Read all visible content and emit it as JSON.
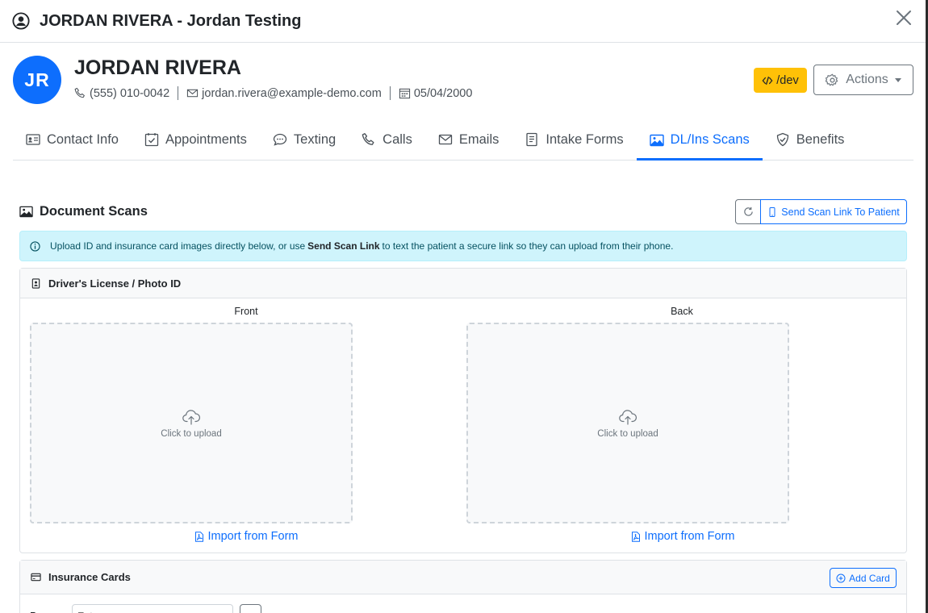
{
  "modal": {
    "title": "JORDAN RIVERA - Jordan Testing"
  },
  "patient": {
    "initials": "JR",
    "name": "JORDAN RIVERA",
    "phone": "(555) 010-0042",
    "email": "jordan.rivera@example-demo.com",
    "dob": "05/04/2000",
    "avatar_color": "#0d6efd"
  },
  "toolbar": {
    "dev_label": "/dev",
    "actions_label": "Actions"
  },
  "tabs": [
    {
      "label": "Contact Info",
      "icon": "contact-card-icon"
    },
    {
      "label": "Appointments",
      "icon": "calendar-check-icon"
    },
    {
      "label": "Texting",
      "icon": "chat-icon"
    },
    {
      "label": "Calls",
      "icon": "phone-icon"
    },
    {
      "label": "Emails",
      "icon": "envelope-icon"
    },
    {
      "label": "Intake Forms",
      "icon": "file-text-icon"
    },
    {
      "label": "DL/Ins Scans",
      "icon": "image-icon",
      "active": true
    },
    {
      "label": "Benefits",
      "icon": "shield-check-icon"
    }
  ],
  "scans": {
    "title": "Document Scans",
    "send_link_label": "Send Scan Link To Patient",
    "info_prefix": "Upload ID and insurance card images directly below, or use",
    "info_bold": "Send Scan Link",
    "info_suffix": "to text the patient a secure link so they can upload from their phone."
  },
  "dl_card": {
    "title": "Driver's License / Photo ID",
    "front_label": "Front",
    "back_label": "Back",
    "upload_text": "Click to upload",
    "import_label": "Import from Form"
  },
  "insurance": {
    "title": "Insurance Cards",
    "add_label": "Add Card",
    "row_label": "Pa",
    "input_placeholder": "Ent"
  },
  "colors": {
    "primary": "#0d6efd",
    "warning": "#ffc107",
    "info_bg": "#cff4fc"
  }
}
